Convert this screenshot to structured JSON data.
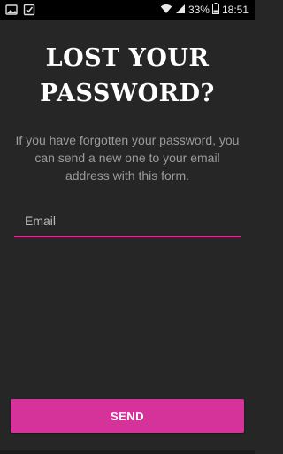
{
  "status_bar": {
    "battery_percent": "33%",
    "time": "18:51",
    "left_icons": [
      "image-notification-icon",
      "checkbox-notification-icon"
    ],
    "right_icons": [
      "wifi-icon",
      "signal-icon",
      "battery-icon"
    ]
  },
  "page": {
    "title_line1": "LOST YOUR",
    "title_line2": "PASSWORD?",
    "description": "If you have forgotten your password, you can send a new one to your email address with this form."
  },
  "form": {
    "email_placeholder": "Email",
    "email_value": "",
    "send_label": "SEND"
  },
  "colors": {
    "background": "#262626",
    "accent": "#d6339a",
    "text_muted": "#9b9b9b"
  }
}
